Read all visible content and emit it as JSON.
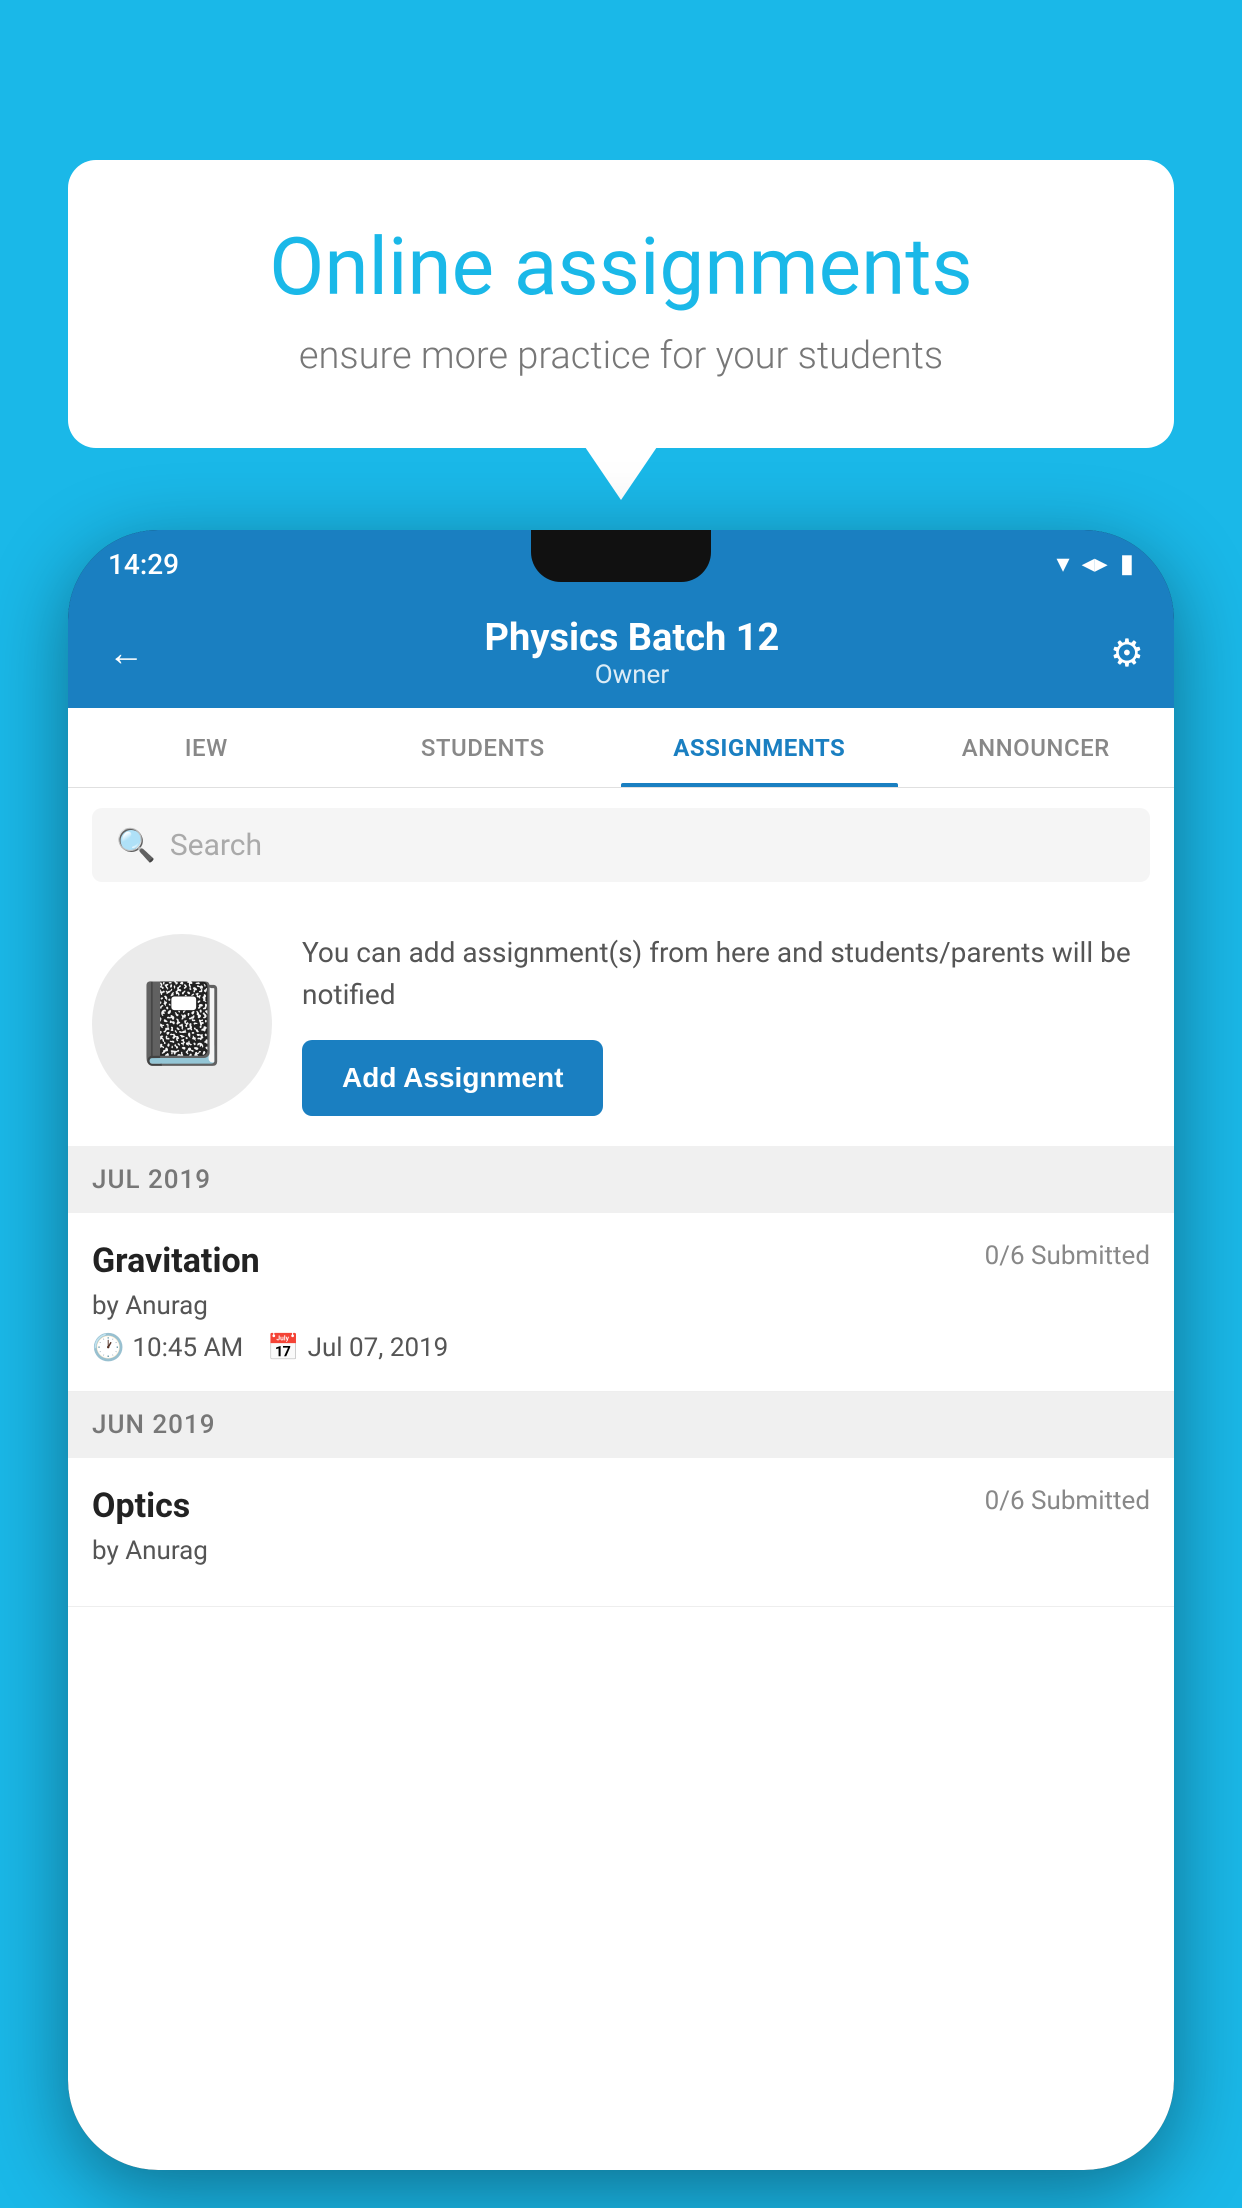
{
  "background_color": "#1ab8e8",
  "speech_bubble": {
    "title": "Online assignments",
    "subtitle": "ensure more practice for your students"
  },
  "phone": {
    "status_bar": {
      "time": "14:29",
      "wifi": "▾",
      "signal": "▲",
      "battery": "▮"
    },
    "header": {
      "title": "Physics Batch 12",
      "subtitle": "Owner",
      "back_label": "←",
      "settings_label": "⚙"
    },
    "tabs": [
      {
        "label": "IEW",
        "active": false
      },
      {
        "label": "STUDENTS",
        "active": false
      },
      {
        "label": "ASSIGNMENTS",
        "active": true
      },
      {
        "label": "ANNOUNCER",
        "active": false
      }
    ],
    "search": {
      "placeholder": "Search"
    },
    "promo": {
      "description": "You can add assignment(s) from here and students/parents will be notified",
      "add_button_label": "Add Assignment"
    },
    "sections": [
      {
        "month_label": "JUL 2019",
        "assignments": [
          {
            "title": "Gravitation",
            "submitted": "0/6 Submitted",
            "by": "by Anurag",
            "time": "10:45 AM",
            "date": "Jul 07, 2019"
          }
        ]
      },
      {
        "month_label": "JUN 2019",
        "assignments": [
          {
            "title": "Optics",
            "submitted": "0/6 Submitted",
            "by": "by Anurag",
            "time": "",
            "date": ""
          }
        ]
      }
    ]
  }
}
